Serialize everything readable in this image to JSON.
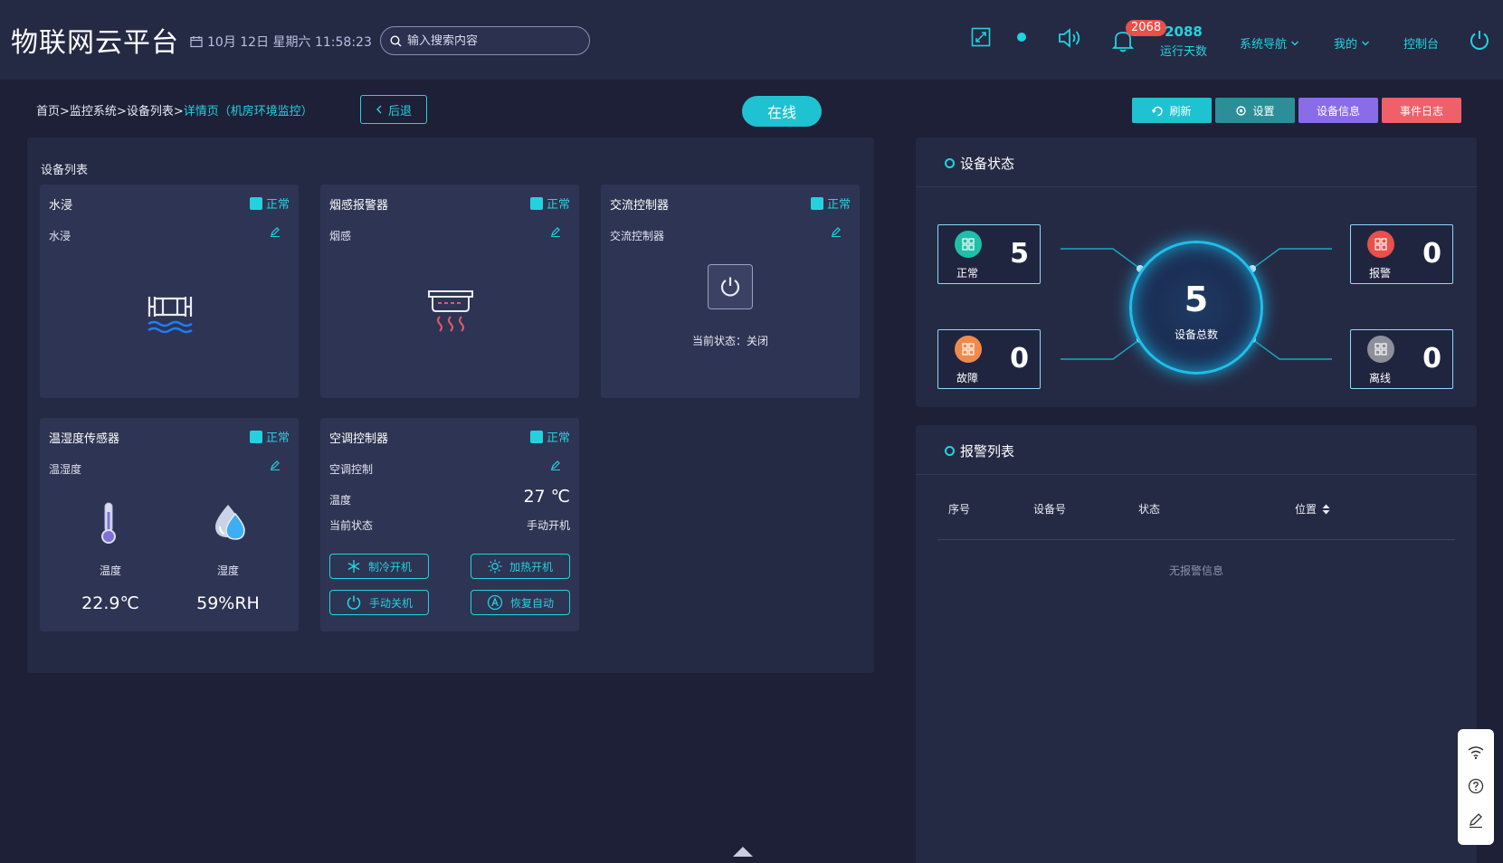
{
  "header": {
    "logo": "物联网云平台",
    "datetime": "10月 12日 星期六 11:58:23",
    "search_placeholder": "输入搜索内容",
    "bell_badge": "2068",
    "run_days_value": "2088",
    "run_days_label": "运行天数",
    "nav": [
      {
        "label": "系统导航"
      },
      {
        "label": "我的"
      },
      {
        "label": "控制台"
      }
    ]
  },
  "subbar": {
    "breadcrumb": {
      "home": "首页",
      "sep": ">",
      "monitor": "监控系统",
      "device_list": "设备列表",
      "current": "详情页（机房环境监控）"
    },
    "back_label": "后退",
    "online_label": "在线",
    "buttons": {
      "refresh": "刷新",
      "settings": "设置",
      "device_info": "设备信息",
      "event_log": "事件日志"
    }
  },
  "device_panel": {
    "title": "设备列表",
    "status_normal": "正常",
    "cards": {
      "water": {
        "title": "水浸",
        "sub": "水浸"
      },
      "smoke": {
        "title": "烟感报警器",
        "sub": "烟感"
      },
      "ac_power": {
        "title": "交流控制器",
        "sub": "交流控制器",
        "state": "当前状态：关闭"
      },
      "thsensor": {
        "title": "温湿度传感器",
        "sub": "温湿度",
        "temp_label": "温度",
        "humid_label": "湿度",
        "temp_value": "22.9℃",
        "humid_value": "59%RH"
      },
      "aircon": {
        "title": "空调控制器",
        "sub": "空调控制",
        "temp_label": "温度",
        "temp_value": "27 ℃",
        "state_label": "当前状态",
        "state_value": "手动开机",
        "btn_cool": "制冷开机",
        "btn_heat": "加热开机",
        "btn_off": "手动关机",
        "btn_auto": "恢复自动"
      }
    }
  },
  "device_status": {
    "title": "设备状态",
    "total_value": "5",
    "total_label": "设备总数",
    "normal": {
      "label": "正常",
      "value": "5"
    },
    "alarm": {
      "label": "报警",
      "value": "0"
    },
    "fault": {
      "label": "故障",
      "value": "0"
    },
    "offline": {
      "label": "离线",
      "value": "0"
    }
  },
  "alarm_list": {
    "title": "报警列表",
    "columns": [
      "序号",
      "设备号",
      "状态",
      "位置"
    ],
    "empty": "无报警信息"
  },
  "colors": {
    "accent": "#23d2df",
    "normal": "#1fbfa8",
    "alarm": "#e8504a",
    "fault": "#f08a4b",
    "offline": "#8d8f99",
    "btn_purple": "#8a6be8",
    "btn_red": "#f0606a"
  }
}
